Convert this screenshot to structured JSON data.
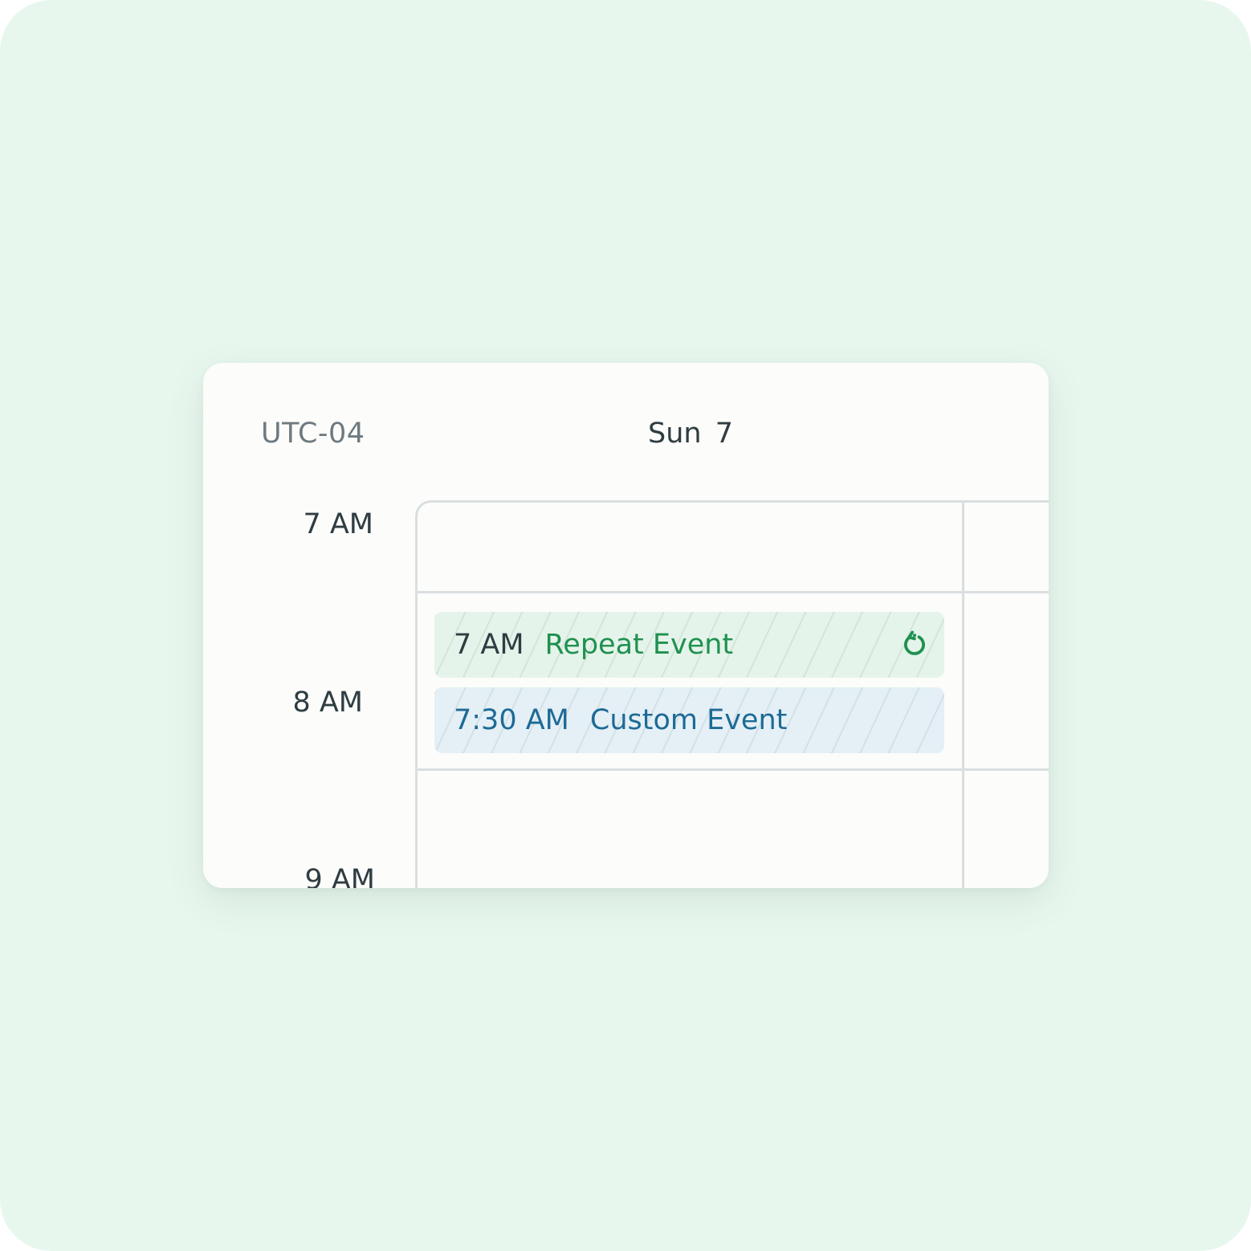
{
  "calendar": {
    "timezone": "UTC-04",
    "day_label": "Sun 7",
    "hours": [
      "7 AM",
      "8 AM",
      "9 AM"
    ],
    "events": [
      {
        "time": "7 AM",
        "title": "Repeat Event",
        "color": "#1f9150",
        "background": "#e5f4ea",
        "icon": "repeat-icon"
      },
      {
        "time": "7:30 AM",
        "title": "Custom Event",
        "color": "#1e6a96",
        "background": "#e4f0f6"
      }
    ]
  }
}
